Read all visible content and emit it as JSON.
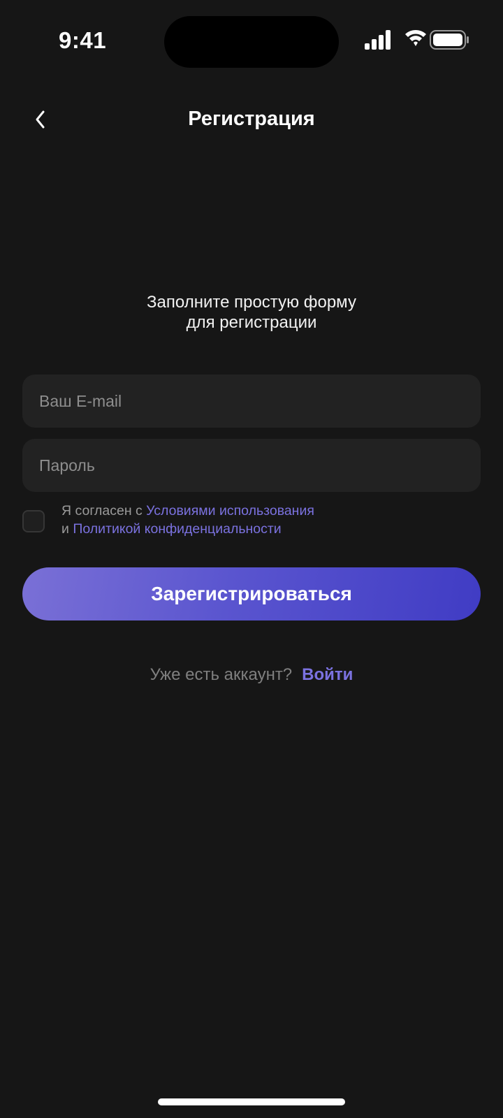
{
  "status_bar": {
    "time": "9:41",
    "icons": [
      "cellular-signal-icon",
      "wifi-icon",
      "battery-icon"
    ]
  },
  "header": {
    "title": "Регистрация",
    "back_icon": "chevron-left-icon"
  },
  "subtitle": {
    "line1": "Заполните простую форму",
    "line2": "для регистрации"
  },
  "form": {
    "email": {
      "placeholder": "Ваш E-mail",
      "value": ""
    },
    "password": {
      "placeholder": "Пароль",
      "value": ""
    },
    "agreement": {
      "checked": false,
      "prefix": "Я согласен с ",
      "terms_link": "Условиями использования",
      "joiner": "и ",
      "privacy_link": "Политикой конфиденциальности"
    },
    "submit_label": "Зарегистрироваться"
  },
  "login": {
    "question": "Уже есть аккаунт?",
    "link": "Войти"
  },
  "colors": {
    "background": "#161616",
    "field": "#222222",
    "accent": "#7b72e0",
    "button_gradient_start": "#7a70d6",
    "button_gradient_end": "#403cc4"
  }
}
